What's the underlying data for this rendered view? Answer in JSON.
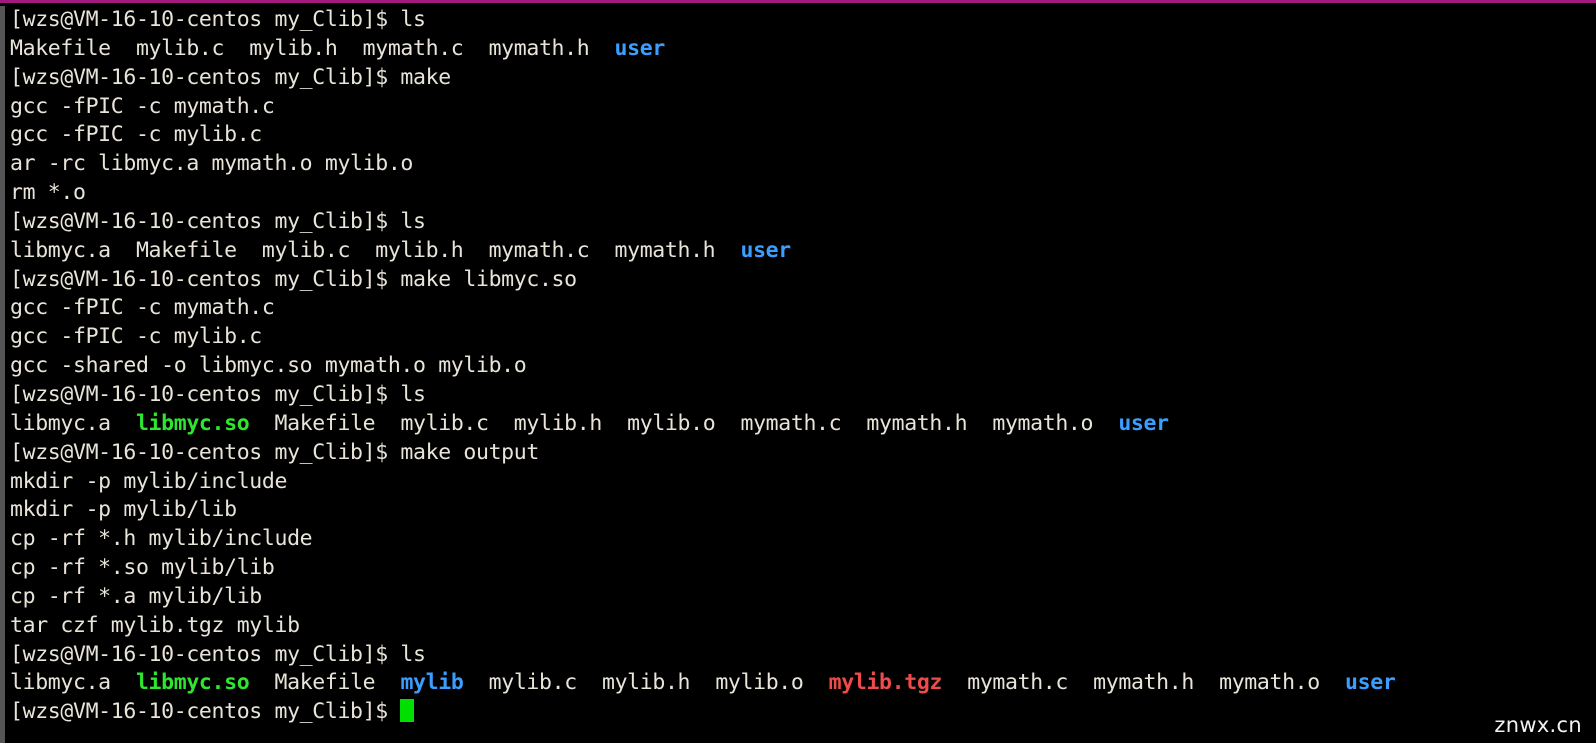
{
  "terminal": {
    "prompt": "[wzs@VM-16-10-centos my_Clib]$ ",
    "colors": {
      "background": "#000000",
      "foreground": "#e9e4d9",
      "directory": "#3b9eff",
      "shared_object": "#2ee62e",
      "archive": "#f04a4a",
      "cursor": "#00e000",
      "top_border": "#a01a7d",
      "scrollbar": "#555555"
    },
    "lines": [
      {
        "type": "prompt",
        "command": "ls"
      },
      {
        "type": "output",
        "segments": [
          {
            "text": "Makefile  mylib.c  mylib.h  mymath.c  mymath.h  ",
            "style": "plain"
          },
          {
            "text": "user",
            "style": "dir"
          }
        ]
      },
      {
        "type": "prompt",
        "command": "make"
      },
      {
        "type": "output",
        "segments": [
          {
            "text": "gcc -fPIC -c mymath.c",
            "style": "plain"
          }
        ]
      },
      {
        "type": "output",
        "segments": [
          {
            "text": "gcc -fPIC -c mylib.c",
            "style": "plain"
          }
        ]
      },
      {
        "type": "output",
        "segments": [
          {
            "text": "ar -rc libmyc.a mymath.o mylib.o",
            "style": "plain"
          }
        ]
      },
      {
        "type": "output",
        "segments": [
          {
            "text": "rm *.o",
            "style": "plain"
          }
        ]
      },
      {
        "type": "prompt",
        "command": "ls"
      },
      {
        "type": "output",
        "segments": [
          {
            "text": "libmyc.a  Makefile  mylib.c  mylib.h  mymath.c  mymath.h  ",
            "style": "plain"
          },
          {
            "text": "user",
            "style": "dir"
          }
        ]
      },
      {
        "type": "prompt",
        "command": "make libmyc.so"
      },
      {
        "type": "output",
        "segments": [
          {
            "text": "gcc -fPIC -c mymath.c",
            "style": "plain"
          }
        ]
      },
      {
        "type": "output",
        "segments": [
          {
            "text": "gcc -fPIC -c mylib.c",
            "style": "plain"
          }
        ]
      },
      {
        "type": "output",
        "segments": [
          {
            "text": "gcc -shared -o libmyc.so mymath.o mylib.o",
            "style": "plain"
          }
        ]
      },
      {
        "type": "prompt",
        "command": "ls"
      },
      {
        "type": "output",
        "segments": [
          {
            "text": "libmyc.a  ",
            "style": "plain"
          },
          {
            "text": "libmyc.so",
            "style": "so"
          },
          {
            "text": "  Makefile  mylib.c  mylib.h  mylib.o  mymath.c  mymath.h  mymath.o  ",
            "style": "plain"
          },
          {
            "text": "user",
            "style": "dir"
          }
        ]
      },
      {
        "type": "prompt",
        "command": "make output"
      },
      {
        "type": "output",
        "segments": [
          {
            "text": "mkdir -p mylib/include",
            "style": "plain"
          }
        ]
      },
      {
        "type": "output",
        "segments": [
          {
            "text": "mkdir -p mylib/lib",
            "style": "plain"
          }
        ]
      },
      {
        "type": "output",
        "segments": [
          {
            "text": "cp -rf *.h mylib/include",
            "style": "plain"
          }
        ]
      },
      {
        "type": "output",
        "segments": [
          {
            "text": "cp -rf *.so mylib/lib",
            "style": "plain"
          }
        ]
      },
      {
        "type": "output",
        "segments": [
          {
            "text": "cp -rf *.a mylib/lib",
            "style": "plain"
          }
        ]
      },
      {
        "type": "output",
        "segments": [
          {
            "text": "tar czf mylib.tgz mylib",
            "style": "plain"
          }
        ]
      },
      {
        "type": "prompt",
        "command": "ls"
      },
      {
        "type": "output",
        "segments": [
          {
            "text": "libmyc.a  ",
            "style": "plain"
          },
          {
            "text": "libmyc.so",
            "style": "so"
          },
          {
            "text": "  Makefile  ",
            "style": "plain"
          },
          {
            "text": "mylib",
            "style": "dir"
          },
          {
            "text": "  mylib.c  mylib.h  mylib.o  ",
            "style": "plain"
          },
          {
            "text": "mylib.tgz",
            "style": "archive"
          },
          {
            "text": "  mymath.c  mymath.h  mymath.o  ",
            "style": "plain"
          },
          {
            "text": "user",
            "style": "dir"
          }
        ]
      },
      {
        "type": "prompt-cursor",
        "command": ""
      }
    ]
  },
  "watermark": {
    "text": "znwx.cn"
  }
}
